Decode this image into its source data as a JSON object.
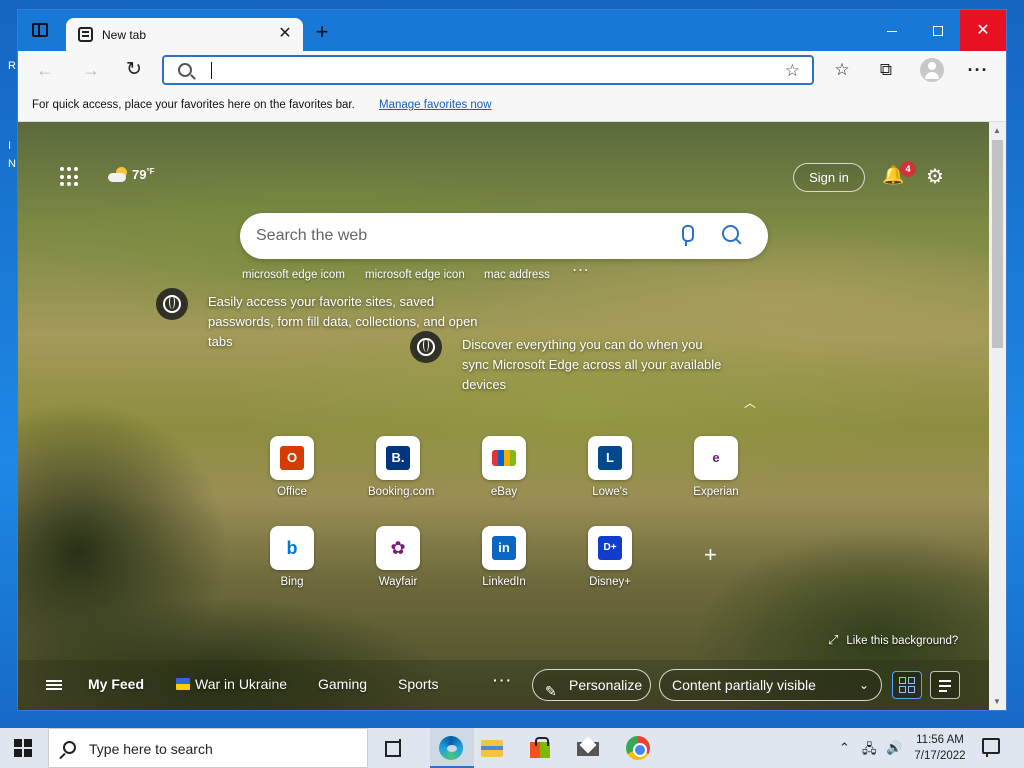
{
  "desktop": {
    "frag_r": "R",
    "frag_i": "I",
    "frag_n": "N"
  },
  "browser": {
    "tab_title": "New tab",
    "close_tab": "✕",
    "new_tab": "+",
    "window_close": "✕"
  },
  "toolbar": {
    "back": "←",
    "forward": "→",
    "refresh": "↻",
    "address_value": "",
    "fav_add": "☆",
    "favorites": "☆",
    "collections": "⧉",
    "more": "···"
  },
  "favorites_bar": {
    "text": "For quick access, place your favorites here on the favorites bar.",
    "link": "Manage favorites now"
  },
  "newtab": {
    "weather_temp": "79",
    "weather_unit": "°F",
    "sign_in": "Sign in",
    "notification_count": "4",
    "bell": "🔔",
    "gear": "⚙",
    "search_placeholder": "Search the web",
    "suggestions": [
      "microsoft edge icom",
      "microsoft edge icon",
      "mac address"
    ],
    "suggestions_more": "···",
    "tip1": "Easily access your favorite sites, saved passwords, form fill data, collections, and open tabs",
    "tip2": "Discover everything you can do when you sync Microsoft Edge across all your available devices",
    "collapse": "︿",
    "tiles": [
      {
        "label": "Office",
        "logo": "O",
        "color": "#d83b01"
      },
      {
        "label": "Booking.com",
        "logo": "B.",
        "color": "#003580"
      },
      {
        "label": "eBay",
        "logo": "",
        "color": "#e53238"
      },
      {
        "label": "Lowe's",
        "logo": "L",
        "color": "#004990"
      },
      {
        "label": "Experian",
        "logo": "e",
        "color": "#6d2077"
      },
      {
        "label": "Bing",
        "logo": "b",
        "color": "#0078d4"
      },
      {
        "label": "Wayfair",
        "logo": "✿",
        "color": "#7f187f"
      },
      {
        "label": "LinkedIn",
        "logo": "in",
        "color": "#0a66c2"
      },
      {
        "label": "Disney+",
        "logo": "D+",
        "color": "#113ccf"
      }
    ],
    "add_site": "+",
    "like_background": "Like this background?",
    "expand": "⤢"
  },
  "feed": {
    "my_feed": "My Feed",
    "items": [
      "War in Ukraine",
      "Gaming",
      "Sports"
    ],
    "more": "···",
    "personalize": "Personalize",
    "pencil": "✎",
    "content_visibility": "Content partially visible",
    "chevron": "⌄"
  },
  "taskbar": {
    "search_text": "Type here to search",
    "tray_up": "⌃",
    "tray_net": "🖧",
    "tray_vol": "🔊",
    "time": "11:56 AM",
    "date": "7/17/2022"
  }
}
